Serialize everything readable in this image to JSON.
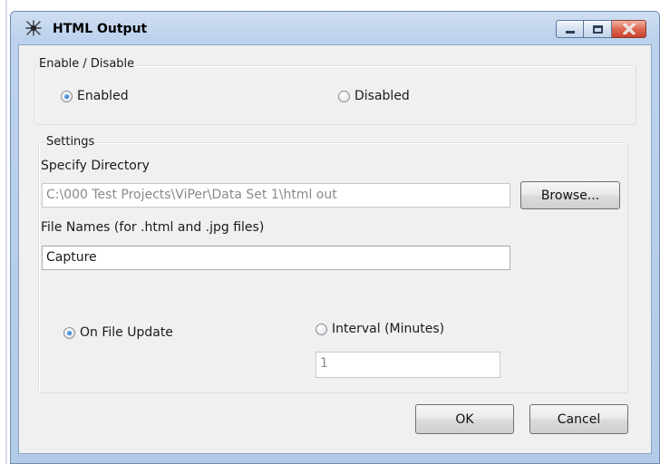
{
  "window": {
    "title": "HTML Output",
    "app_icon": "spider-icon",
    "controls": [
      "minimize-icon",
      "maximize-icon",
      "close-icon"
    ]
  },
  "enable_group": {
    "label": "Enable / Disable",
    "options": [
      {
        "label": "Enabled",
        "selected": true
      },
      {
        "label": "Disabled",
        "selected": false
      }
    ]
  },
  "settings_group": {
    "label": "Settings",
    "directory_label": "Specify Directory",
    "directory_value": "C:\\000 Test Projects\\ViPer\\Data Set 1\\html out",
    "browse_label": "Browse...",
    "filenames_label": "File Names (for .html and .jpg files)",
    "filenames_value": "Capture",
    "trigger_options": [
      {
        "label": "On File Update",
        "selected": true
      },
      {
        "label": "Interval (Minutes)",
        "selected": false
      }
    ],
    "interval_value": "1"
  },
  "footer": {
    "ok_label": "OK",
    "cancel_label": "Cancel"
  }
}
